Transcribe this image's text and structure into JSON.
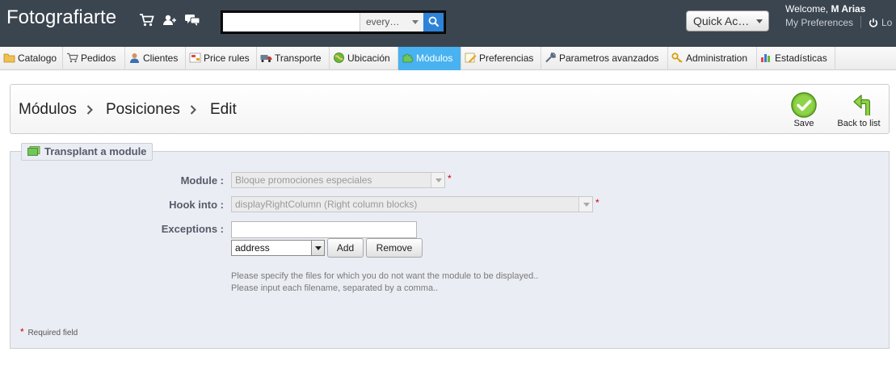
{
  "header": {
    "shop_name": "Fotografiarte",
    "icons": [
      "cart-icon",
      "customers-icon",
      "messages-icon"
    ],
    "search": {
      "placeholder": "",
      "value": "",
      "scope": "every…"
    },
    "quick_access": "Quick Ac…",
    "welcome_prefix": "Welcome, ",
    "user_name": "M Arias",
    "my_preferences": "My Preferences",
    "logout": "Lo"
  },
  "menu": {
    "active_color": "#49b2f0",
    "tabs": [
      {
        "label": "Catalogo",
        "icon": "folder-icon"
      },
      {
        "label": "Pedidos",
        "icon": "cart-icon"
      },
      {
        "label": "Clientes",
        "icon": "user-icon"
      },
      {
        "label": "Price rules",
        "icon": "price-rules-icon"
      },
      {
        "label": "Transporte",
        "icon": "truck-icon"
      },
      {
        "label": "Ubicación",
        "icon": "globe-icon"
      },
      {
        "label": "Módulos",
        "icon": "puzzle-icon",
        "active": true
      },
      {
        "label": "Preferencias",
        "icon": "preferences-icon"
      },
      {
        "label": "Parametros avanzados",
        "icon": "wrench-icon"
      },
      {
        "label": "Administration",
        "icon": "key-icon"
      },
      {
        "label": "Estadísticas",
        "icon": "stats-icon"
      }
    ]
  },
  "breadcrumb": {
    "items": [
      "Módulos",
      "Posiciones",
      "Edit"
    ]
  },
  "toolbar": {
    "save_label": "Save",
    "back_label": "Back to list"
  },
  "form": {
    "legend": "Transplant a module",
    "module_label": "Module :",
    "module_value": "Bloque promociones especiales",
    "hook_label": "Hook into :",
    "hook_value": "displayRightColumn (Right column blocks)",
    "exceptions_label": "Exceptions :",
    "exceptions_value": "",
    "file_select_value": "address",
    "add_label": "Add",
    "remove_label": "Remove",
    "hint_line1": "Please specify the files for which you do not want the module to be displayed..",
    "hint_line2": "Please input each filename, separated by a comma..",
    "required_star": "*",
    "required_note": "Required field"
  }
}
